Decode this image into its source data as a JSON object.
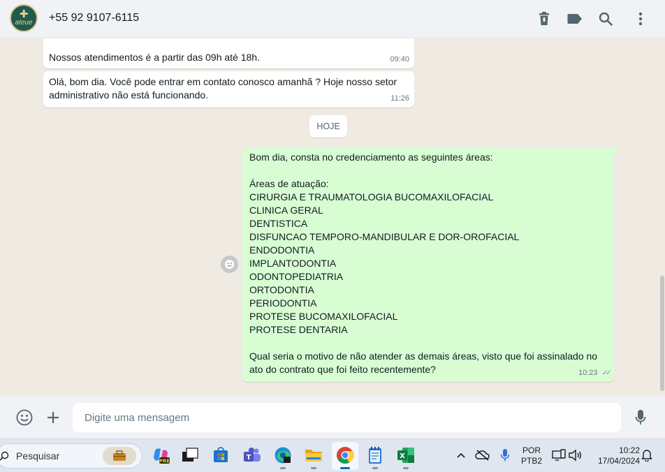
{
  "header": {
    "avatar_mark": "✚",
    "avatar_text": "ateue",
    "contact_name": "+55 92 9107-6115",
    "icons": [
      "delete-icon",
      "label-icon",
      "search-icon",
      "menu-icon"
    ]
  },
  "messages": [
    {
      "direction": "in",
      "lines": [
        "Nossos atendimentos é a partir das 09h até 18h."
      ],
      "time": "09:40"
    },
    {
      "direction": "in",
      "lines": [
        "Olá, bom dia. Você pode entrar em contato conosco amanhã ? Hoje nosso setor",
        "administrativo não está funcionando."
      ],
      "time": "11:26"
    },
    {
      "direction": "out",
      "lines": [
        "Bom dia, consta no credenciamento as seguintes áreas:",
        "",
        "Áreas de atuação:",
        "CIRURGIA E TRAUMATOLOGIA BUCOMAXILOFACIAL",
        "CLINICA GERAL",
        "DENTISTICA",
        "DISFUNCAO TEMPORO-MANDIBULAR E DOR-OROFACIAL",
        "ENDODONTIA",
        "IMPLANTODONTIA",
        "ODONTOPEDIATRIA",
        "ORTODONTIA",
        "PERIODONTIA",
        "PROTESE BUCOMAXILOFACIAL",
        "PROTESE DENTARIA",
        "",
        "Qual seria o motivo de não atender as demais áreas, visto que foi assinalado no",
        "ato do contrato que foi feito recentemente?"
      ],
      "time": "10:23",
      "status": "read"
    }
  ],
  "day_divider": "HOJE",
  "composer": {
    "placeholder": "Digite uma mensagem",
    "icons": [
      "emoji-icon",
      "attach-plus-icon",
      "microphone-icon"
    ]
  },
  "taskbar": {
    "search_label": "Pesquisar",
    "apps": [
      "work-briefcase",
      "copilot-pre",
      "task-view",
      "microsoft-store",
      "teams",
      "edge",
      "file-explorer",
      "chrome",
      "notepad",
      "excel"
    ],
    "active_app": "chrome",
    "tray": {
      "language_line1": "POR",
      "language_line2": "PTB2",
      "time": "10:22",
      "date": "17/04/2024"
    }
  },
  "colors": {
    "header_bg": "#f0f2f5",
    "chat_bg": "#efeae2",
    "incoming_bubble": "#ffffff",
    "outgoing_bubble": "#d9fdd3",
    "taskbar_bg": "#dfe6ef"
  }
}
